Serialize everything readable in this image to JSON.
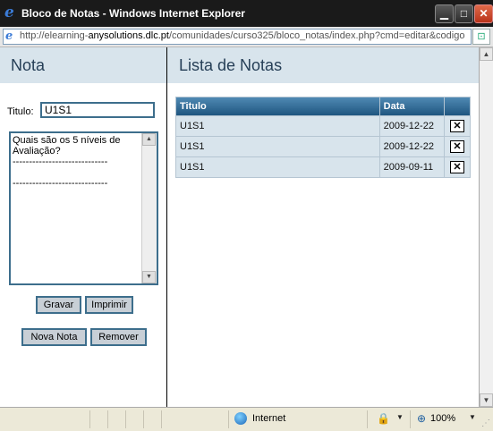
{
  "window": {
    "title": "Bloco de Notas - Windows Internet Explorer",
    "url_prefix": "http://elearning-",
    "url_domain": "anysolutions.dlc.pt",
    "url_rest": "/comunidades/curso325/bloco_notas/index.php?cmd=editar&codigo"
  },
  "left_panel": {
    "heading": "Nota",
    "title_label": "Titulo:",
    "title_value": "U1S1",
    "body_text": "Quais são os 5 níveis de Avaliação?\n-----------------------------\n\n-----------------------------",
    "buttons": {
      "gravar": "Gravar",
      "imprimir": "Imprimir",
      "nova_nota": "Nova Nota",
      "remover": "Remover"
    }
  },
  "right_panel": {
    "heading": "Lista de Notas",
    "columns": [
      "Titulo",
      "Data",
      ""
    ],
    "rows": [
      {
        "titulo": "U1S1",
        "data": "2009-12-22"
      },
      {
        "titulo": "U1S1",
        "data": "2009-12-22"
      },
      {
        "titulo": "U1S1",
        "data": "2009-09-11"
      }
    ],
    "delete_glyph": "✕"
  },
  "status_bar": {
    "zone": "Internet",
    "zoom": "100%"
  },
  "colors": {
    "panel_header_bg": "#d8e4ec",
    "panel_header_text": "#263f57",
    "table_header": "#1f5680",
    "row_bg": "#d8e4ec",
    "button_border": "#3d6e8c"
  },
  "icons": {
    "browser": "ie-logo-icon",
    "page": "page-icon",
    "compat": "compatibility-view-icon",
    "zone": "globe-icon",
    "security": "lock-icon",
    "zoom": "zoom-icon"
  }
}
